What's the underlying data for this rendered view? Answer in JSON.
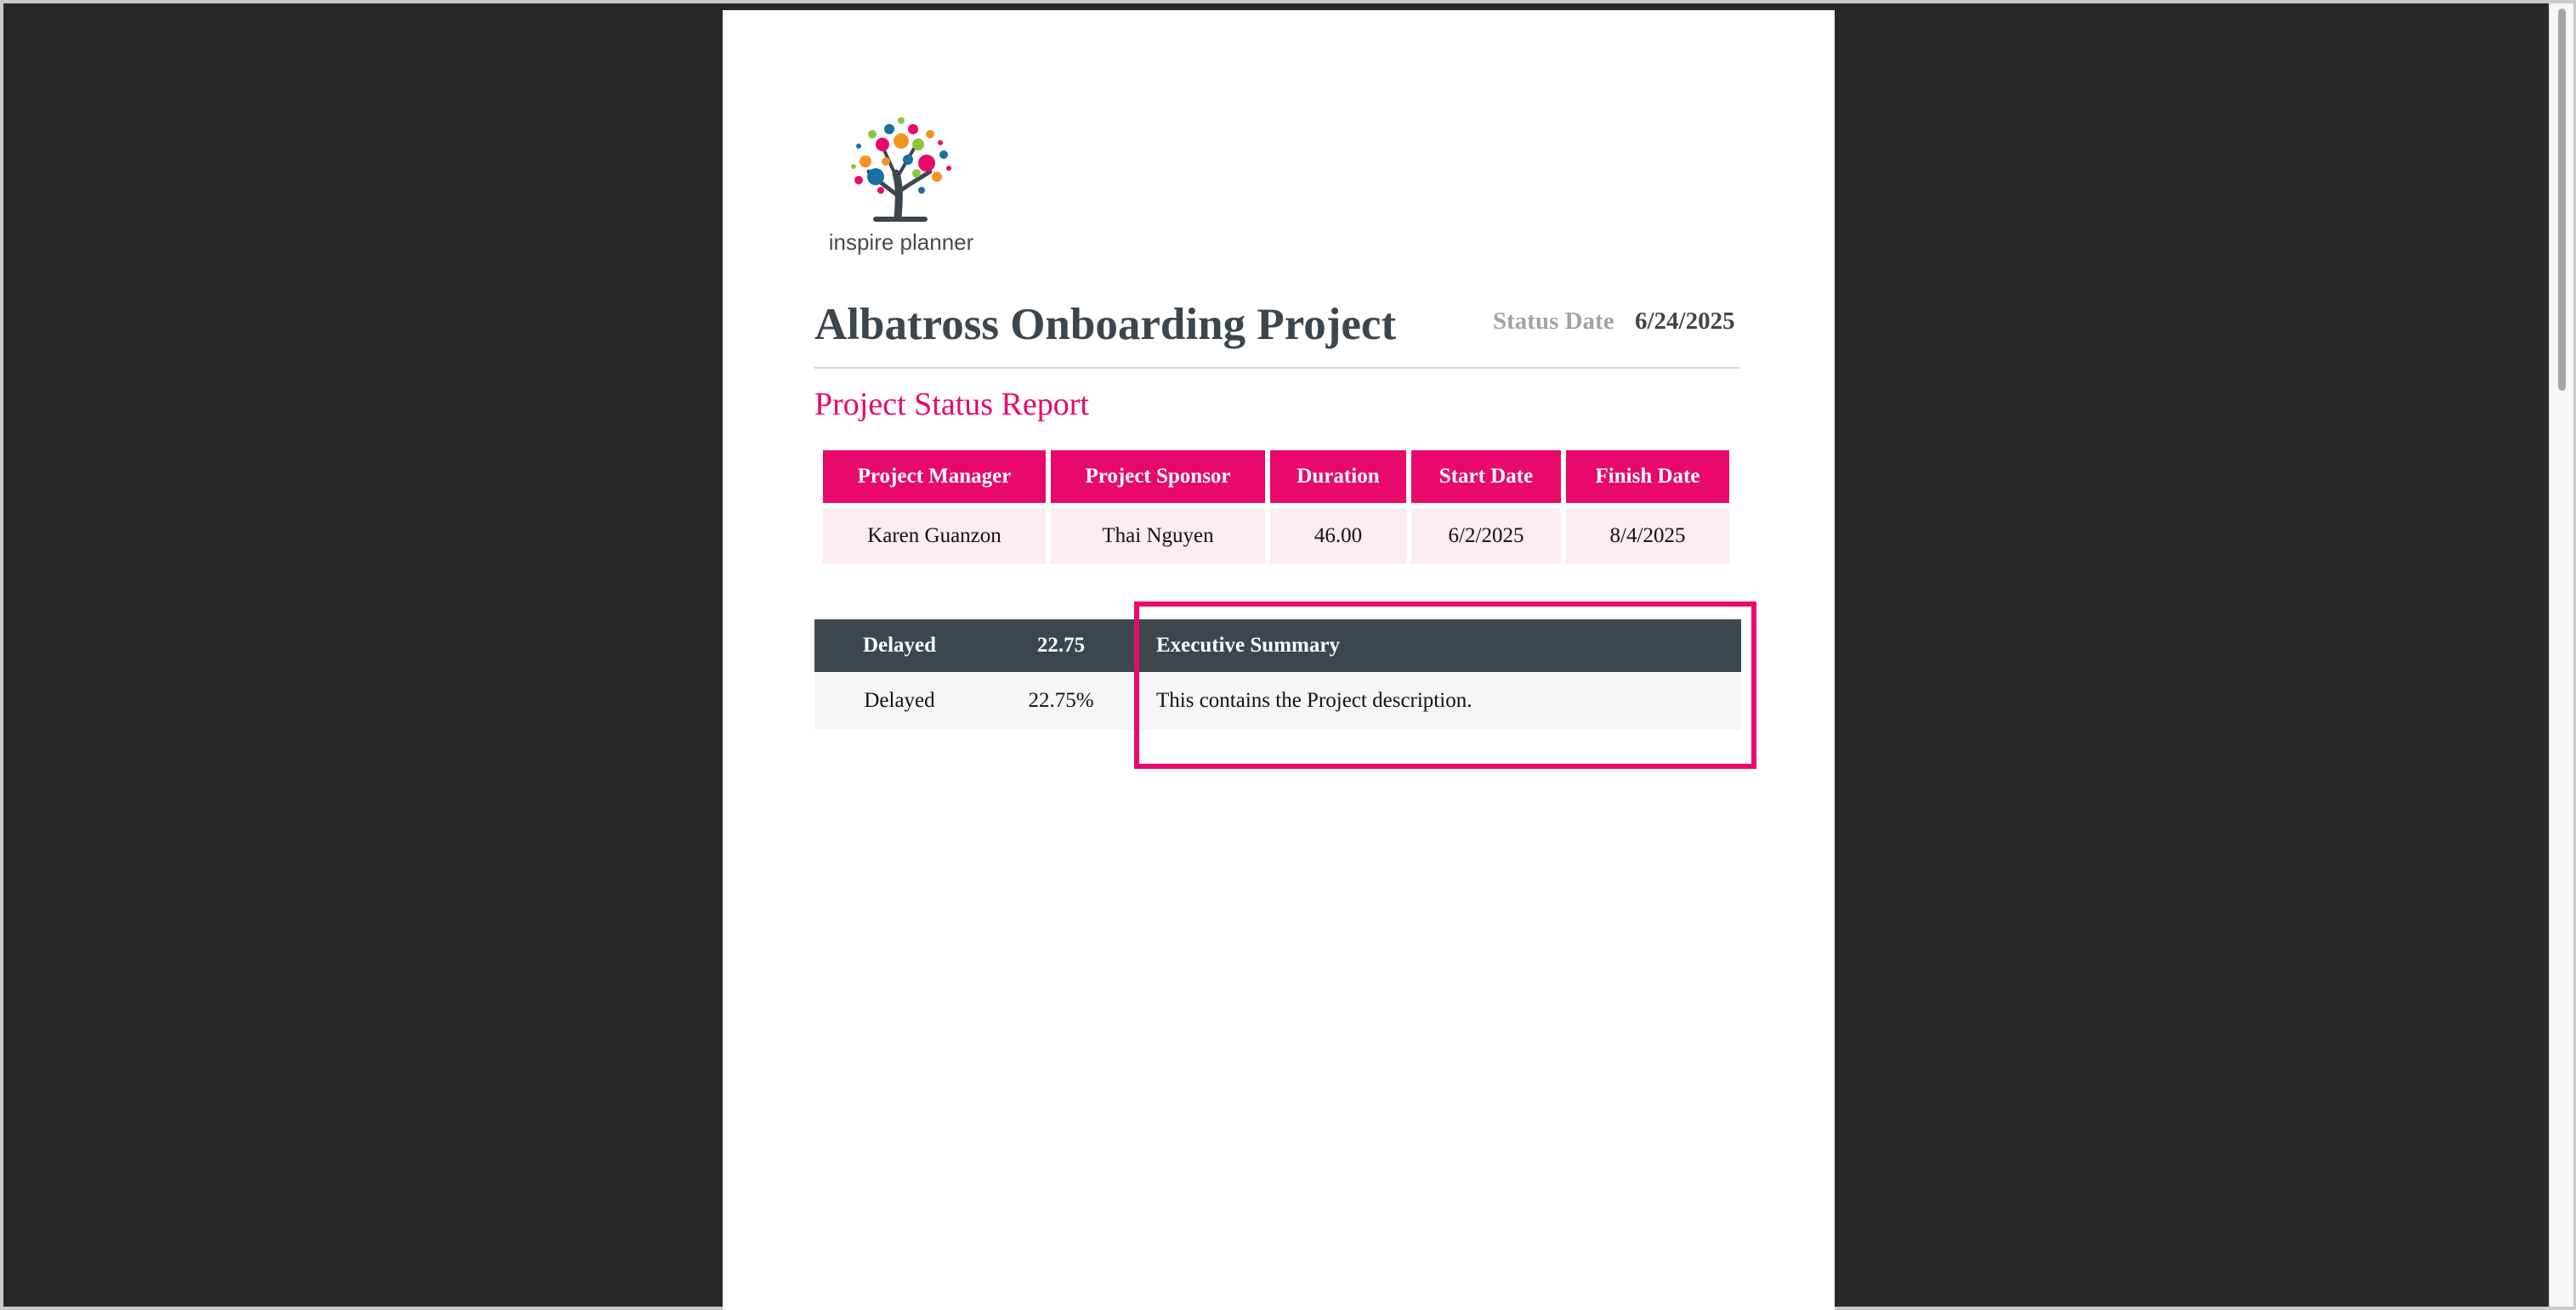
{
  "brand": {
    "logo_text": "inspire planner"
  },
  "report": {
    "title": "Albatross Onboarding Project",
    "status_date_label": "Status Date",
    "status_date_value": "6/24/2025",
    "subtitle": "Project Status Report"
  },
  "info_table": {
    "headers": [
      "Project Manager",
      "Project Sponsor",
      "Duration",
      "Start Date",
      "Finish Date"
    ],
    "values": [
      "Karen Guanzon",
      "Thai Nguyen",
      "46.00",
      "6/2/2025",
      "8/4/2025"
    ]
  },
  "status_table": {
    "headers": [
      "Delayed",
      "22.75",
      "Executive Summary"
    ],
    "values": [
      "Delayed",
      "22.75%",
      "This contains the Project description."
    ]
  },
  "colors": {
    "accent": "#e8096a",
    "dark": "#3d464c",
    "viewer_background": "#282828"
  },
  "icons": [
    "tree-logo-icon"
  ]
}
